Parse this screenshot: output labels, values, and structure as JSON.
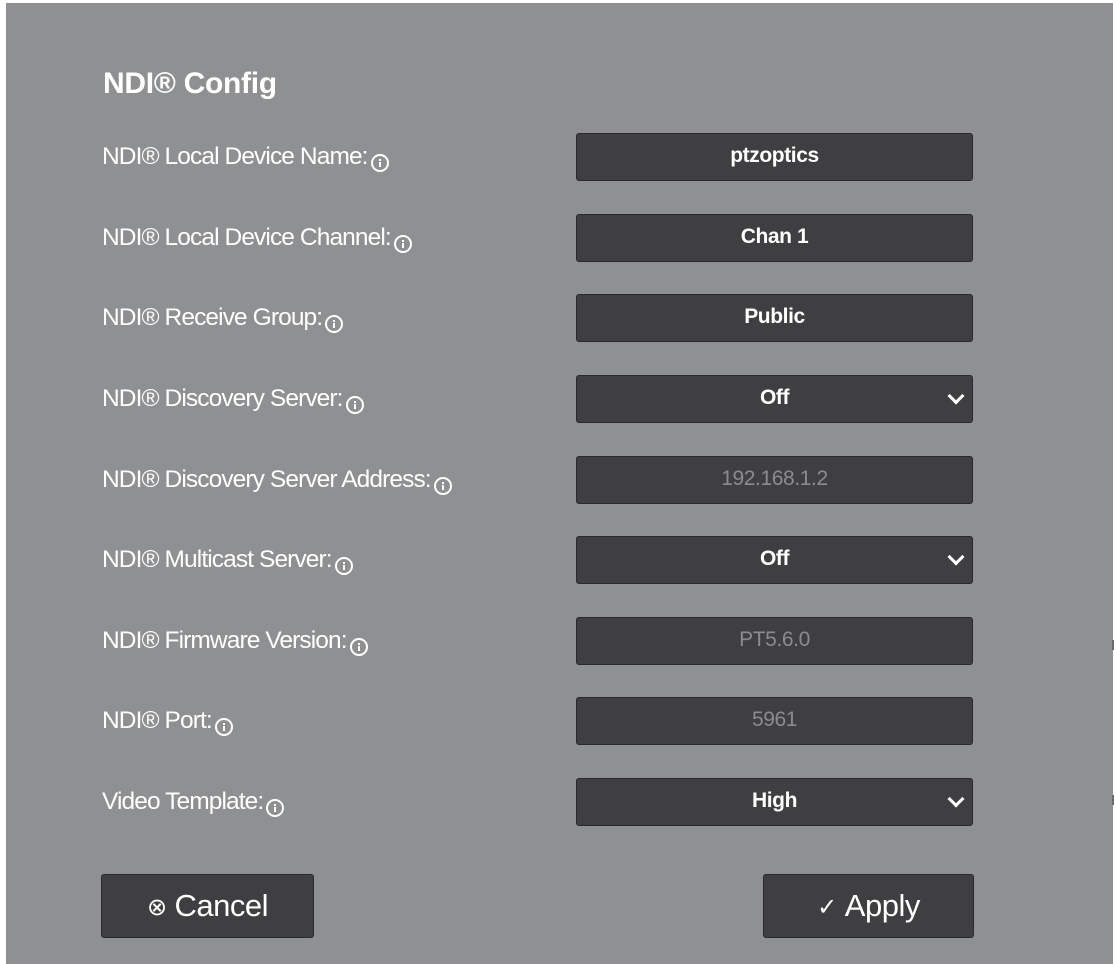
{
  "title": "NDI® Config",
  "rows": [
    {
      "label": "NDI® Local Device Name:",
      "value": "ptzoptics",
      "type": "input",
      "info_icon": "info-icon"
    },
    {
      "label": "NDI® Local Device Channel:",
      "value": "Chan 1",
      "type": "input",
      "info_icon": "info-icon"
    },
    {
      "label": "NDI® Receive Group:",
      "value": "Public",
      "type": "input",
      "info_icon": "info-icon"
    },
    {
      "label": "NDI® Discovery Server:",
      "value": "Off",
      "type": "select",
      "info_icon": "info-icon"
    },
    {
      "label": "NDI® Discovery Server Address:",
      "value": "192.168.1.2",
      "type": "input-disabled",
      "info_icon": "info-icon"
    },
    {
      "label": "NDI® Multicast Server:",
      "value": "Off",
      "type": "select",
      "info_icon": "info-icon"
    },
    {
      "label": "NDI® Firmware Version:",
      "value": "PT5.6.0",
      "type": "input-disabled",
      "info_icon": "info-icon"
    },
    {
      "label": "NDI® Port:",
      "value": "5961",
      "type": "input-disabled",
      "info_icon": "info-icon"
    },
    {
      "label": "Video Template:",
      "value": "High",
      "type": "select",
      "info_icon": "info-icon"
    }
  ],
  "buttons": {
    "cancel": {
      "label": "Cancel",
      "icon": "x-circle-icon",
      "glyph": "⊗"
    },
    "apply": {
      "label": "Apply",
      "icon": "check-circle-icon",
      "glyph": "✓"
    }
  },
  "colors": {
    "panel_bg": "#8f9092",
    "field_bg": "#3f3f41",
    "disabled_text": "#8c8c8e",
    "text": "#ffffff"
  }
}
